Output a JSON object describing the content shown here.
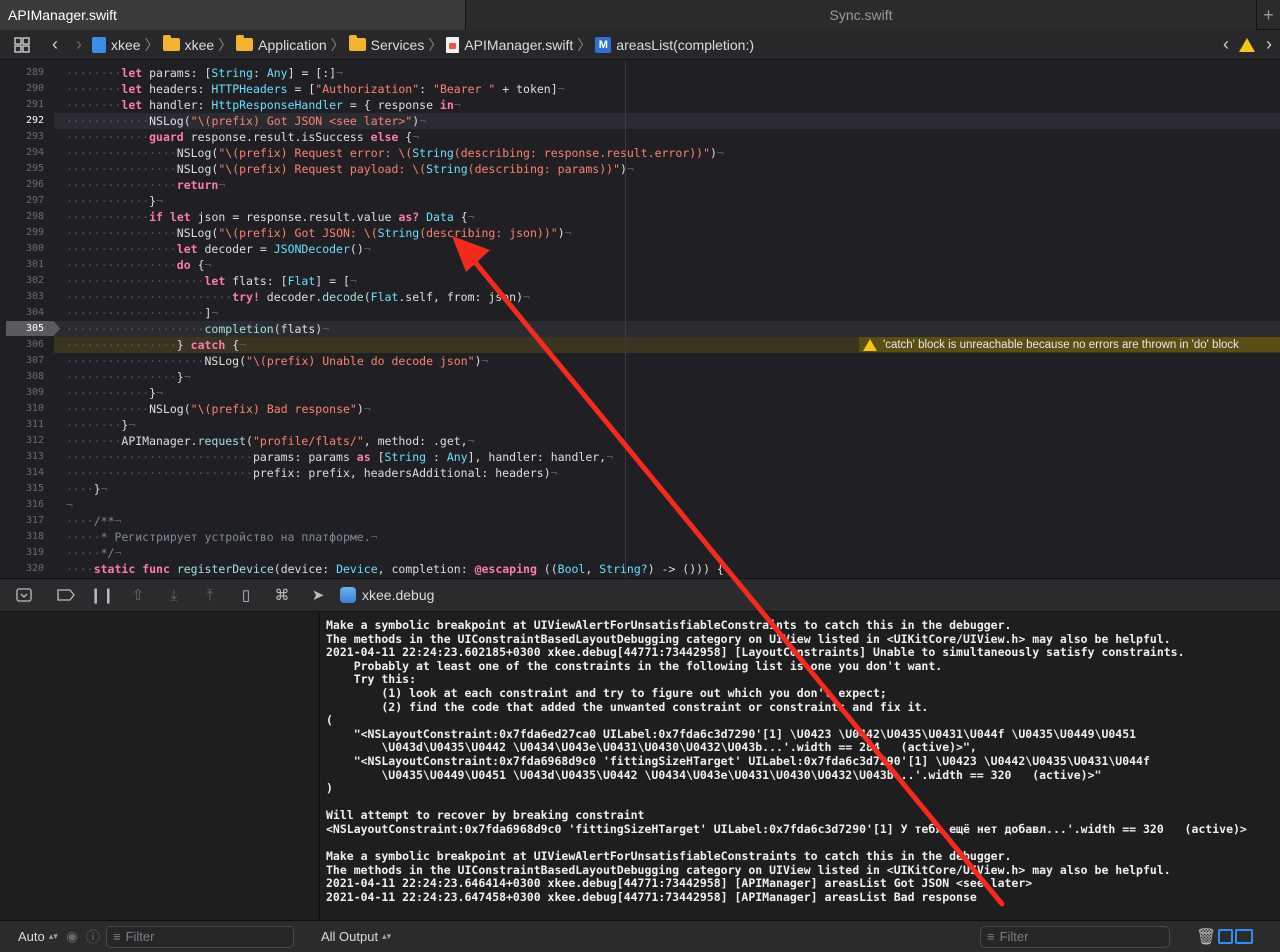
{
  "tabs": {
    "active": "APIManager.swift",
    "inactive": "Sync.swift",
    "add": "+"
  },
  "jumpbar": {
    "crumbs": [
      "xkee",
      "xkee",
      "Application",
      "Services",
      "APIManager.swift",
      "areasList(completion:)"
    ],
    "method_badge": "M"
  },
  "editor": {
    "current_line": 292,
    "breakpoint_line": 305,
    "warning": "'catch' block is unreachable because no errors are thrown in 'do' block",
    "lines": [
      {
        "n": "289",
        "code": "        let params: [String: Any] = [:]"
      },
      {
        "n": "290",
        "code": "        let headers: HTTPHeaders = [\"Authorization\": \"Bearer \" + token]"
      },
      {
        "n": "291",
        "code": "        let handler: HttpResponseHandler = { response in"
      },
      {
        "n": "292",
        "code": "            NSLog(\"\\(prefix) Got JSON <see later>\")"
      },
      {
        "n": "293",
        "code": "            guard response.result.isSuccess else {"
      },
      {
        "n": "294",
        "code": "                NSLog(\"\\(prefix) Request error: \\(String(describing: response.result.error))\")"
      },
      {
        "n": "295",
        "code": "                NSLog(\"\\(prefix) Request payload: \\(String(describing: params))\")"
      },
      {
        "n": "296",
        "code": "                return"
      },
      {
        "n": "297",
        "code": "            }"
      },
      {
        "n": "298",
        "code": "            if let json = response.result.value as? Data {"
      },
      {
        "n": "299",
        "code": "                NSLog(\"\\(prefix) Got JSON: \\(String(describing: json))\")"
      },
      {
        "n": "300",
        "code": "                let decoder = JSONDecoder()"
      },
      {
        "n": "301",
        "code": "                do {"
      },
      {
        "n": "302",
        "code": "                    let flats: [Flat] = ["
      },
      {
        "n": "303",
        "code": "                        try! decoder.decode(Flat.self, from: json)"
      },
      {
        "n": "304",
        "code": "                    ]"
      },
      {
        "n": "305",
        "code": "                    completion(flats)"
      },
      {
        "n": "306",
        "code": "                } catch {"
      },
      {
        "n": "307",
        "code": "                    NSLog(\"\\(prefix) Unable do decode json\")"
      },
      {
        "n": "308",
        "code": "                }"
      },
      {
        "n": "309",
        "code": "            }"
      },
      {
        "n": "310",
        "code": "            NSLog(\"\\(prefix) Bad response\")"
      },
      {
        "n": "311",
        "code": "        }"
      },
      {
        "n": "312",
        "code": "        APIManager.request(\"profile/flats/\", method: .get,"
      },
      {
        "n": "313",
        "code": "                           params: params as [String : Any], handler: handler,"
      },
      {
        "n": "314",
        "code": "                           prefix: prefix, headersAdditional: headers)"
      },
      {
        "n": "315",
        "code": "    }"
      },
      {
        "n": "316",
        "code": ""
      },
      {
        "n": "317",
        "code": "    /**"
      },
      {
        "n": "318",
        "code": "     * Регистрирует устройство на платформе."
      },
      {
        "n": "319",
        "code": "     */"
      },
      {
        "n": "320",
        "code": "    static func registerDevice(device: Device, completion: @escaping ((Bool, String?) -> ())) {"
      }
    ]
  },
  "debugbar": {
    "target": "xkee.debug"
  },
  "console": {
    "lines": [
      "Make a symbolic breakpoint at UIViewAlertForUnsatisfiableConstraints to catch this in the debugger.",
      "The methods in the UIConstraintBasedLayoutDebugging category on UIView listed in <UIKitCore/UIView.h> may also be helpful.",
      "2021-04-11 22:24:23.602185+0300 xkee.debug[44771:73442958] [LayoutConstraints] Unable to simultaneously satisfy constraints.",
      "    Probably at least one of the constraints in the following list is one you don't want.",
      "    Try this:",
      "        (1) look at each constraint and try to figure out which you don't expect;",
      "        (2) find the code that added the unwanted constraint or constraints and fix it.",
      "(",
      "    \"<NSLayoutConstraint:0x7fda6ed27ca0 UILabel:0x7fda6c3d7290'[1] \\U0423 \\U0442\\U0435\\U0431\\U044f \\U0435\\U0449\\U0451",
      "        \\U043d\\U0435\\U0442 \\U0434\\U043e\\U0431\\U0430\\U0432\\U043b...'.width == 284   (active)>\",",
      "    \"<NSLayoutConstraint:0x7fda6968d9c0 'fittingSizeHTarget' UILabel:0x7fda6c3d7290'[1] \\U0423 \\U0442\\U0435\\U0431\\U044f",
      "        \\U0435\\U0449\\U0451 \\U043d\\U0435\\U0442 \\U0434\\U043e\\U0431\\U0430\\U0432\\U043b...'.width == 320   (active)>\"",
      ")",
      "",
      "Will attempt to recover by breaking constraint",
      "<NSLayoutConstraint:0x7fda6968d9c0 'fittingSizeHTarget' UILabel:0x7fda6c3d7290'[1] У тебя ещё нет добавл...'.width == 320   (active)>",
      "",
      "Make a symbolic breakpoint at UIViewAlertForUnsatisfiableConstraints to catch this in the debugger.",
      "The methods in the UIConstraintBasedLayoutDebugging category on UIView listed in <UIKitCore/UIView.h> may also be helpful.",
      "2021-04-11 22:24:23.646414+0300 xkee.debug[44771:73442958] [APIManager] areasList Got JSON <see later>",
      "2021-04-11 22:24:23.647458+0300 xkee.debug[44771:73442958] [APIManager] areasList Bad response"
    ]
  },
  "bottombar": {
    "auto_label": "Auto",
    "var_filter_placeholder": "Filter",
    "output_label": "All Output",
    "console_filter_placeholder": "Filter"
  },
  "colors": {
    "annotation_arrow": "#f42a1f",
    "warning_banner": "#5a4e14",
    "current_line": "#2b2c33",
    "breakpoint_line": "#3c3c40"
  }
}
